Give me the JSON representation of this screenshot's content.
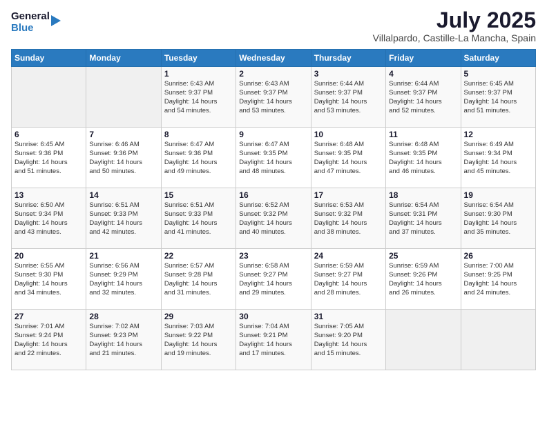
{
  "logo": {
    "general": "General",
    "blue": "Blue"
  },
  "title": "July 2025",
  "location": "Villalpardo, Castille-La Mancha, Spain",
  "headers": [
    "Sunday",
    "Monday",
    "Tuesday",
    "Wednesday",
    "Thursday",
    "Friday",
    "Saturday"
  ],
  "weeks": [
    [
      {
        "day": "",
        "info": ""
      },
      {
        "day": "",
        "info": ""
      },
      {
        "day": "1",
        "info": "Sunrise: 6:43 AM\nSunset: 9:37 PM\nDaylight: 14 hours\nand 54 minutes."
      },
      {
        "day": "2",
        "info": "Sunrise: 6:43 AM\nSunset: 9:37 PM\nDaylight: 14 hours\nand 53 minutes."
      },
      {
        "day": "3",
        "info": "Sunrise: 6:44 AM\nSunset: 9:37 PM\nDaylight: 14 hours\nand 53 minutes."
      },
      {
        "day": "4",
        "info": "Sunrise: 6:44 AM\nSunset: 9:37 PM\nDaylight: 14 hours\nand 52 minutes."
      },
      {
        "day": "5",
        "info": "Sunrise: 6:45 AM\nSunset: 9:37 PM\nDaylight: 14 hours\nand 51 minutes."
      }
    ],
    [
      {
        "day": "6",
        "info": "Sunrise: 6:45 AM\nSunset: 9:36 PM\nDaylight: 14 hours\nand 51 minutes."
      },
      {
        "day": "7",
        "info": "Sunrise: 6:46 AM\nSunset: 9:36 PM\nDaylight: 14 hours\nand 50 minutes."
      },
      {
        "day": "8",
        "info": "Sunrise: 6:47 AM\nSunset: 9:36 PM\nDaylight: 14 hours\nand 49 minutes."
      },
      {
        "day": "9",
        "info": "Sunrise: 6:47 AM\nSunset: 9:35 PM\nDaylight: 14 hours\nand 48 minutes."
      },
      {
        "day": "10",
        "info": "Sunrise: 6:48 AM\nSunset: 9:35 PM\nDaylight: 14 hours\nand 47 minutes."
      },
      {
        "day": "11",
        "info": "Sunrise: 6:48 AM\nSunset: 9:35 PM\nDaylight: 14 hours\nand 46 minutes."
      },
      {
        "day": "12",
        "info": "Sunrise: 6:49 AM\nSunset: 9:34 PM\nDaylight: 14 hours\nand 45 minutes."
      }
    ],
    [
      {
        "day": "13",
        "info": "Sunrise: 6:50 AM\nSunset: 9:34 PM\nDaylight: 14 hours\nand 43 minutes."
      },
      {
        "day": "14",
        "info": "Sunrise: 6:51 AM\nSunset: 9:33 PM\nDaylight: 14 hours\nand 42 minutes."
      },
      {
        "day": "15",
        "info": "Sunrise: 6:51 AM\nSunset: 9:33 PM\nDaylight: 14 hours\nand 41 minutes."
      },
      {
        "day": "16",
        "info": "Sunrise: 6:52 AM\nSunset: 9:32 PM\nDaylight: 14 hours\nand 40 minutes."
      },
      {
        "day": "17",
        "info": "Sunrise: 6:53 AM\nSunset: 9:32 PM\nDaylight: 14 hours\nand 38 minutes."
      },
      {
        "day": "18",
        "info": "Sunrise: 6:54 AM\nSunset: 9:31 PM\nDaylight: 14 hours\nand 37 minutes."
      },
      {
        "day": "19",
        "info": "Sunrise: 6:54 AM\nSunset: 9:30 PM\nDaylight: 14 hours\nand 35 minutes."
      }
    ],
    [
      {
        "day": "20",
        "info": "Sunrise: 6:55 AM\nSunset: 9:30 PM\nDaylight: 14 hours\nand 34 minutes."
      },
      {
        "day": "21",
        "info": "Sunrise: 6:56 AM\nSunset: 9:29 PM\nDaylight: 14 hours\nand 32 minutes."
      },
      {
        "day": "22",
        "info": "Sunrise: 6:57 AM\nSunset: 9:28 PM\nDaylight: 14 hours\nand 31 minutes."
      },
      {
        "day": "23",
        "info": "Sunrise: 6:58 AM\nSunset: 9:27 PM\nDaylight: 14 hours\nand 29 minutes."
      },
      {
        "day": "24",
        "info": "Sunrise: 6:59 AM\nSunset: 9:27 PM\nDaylight: 14 hours\nand 28 minutes."
      },
      {
        "day": "25",
        "info": "Sunrise: 6:59 AM\nSunset: 9:26 PM\nDaylight: 14 hours\nand 26 minutes."
      },
      {
        "day": "26",
        "info": "Sunrise: 7:00 AM\nSunset: 9:25 PM\nDaylight: 14 hours\nand 24 minutes."
      }
    ],
    [
      {
        "day": "27",
        "info": "Sunrise: 7:01 AM\nSunset: 9:24 PM\nDaylight: 14 hours\nand 22 minutes."
      },
      {
        "day": "28",
        "info": "Sunrise: 7:02 AM\nSunset: 9:23 PM\nDaylight: 14 hours\nand 21 minutes."
      },
      {
        "day": "29",
        "info": "Sunrise: 7:03 AM\nSunset: 9:22 PM\nDaylight: 14 hours\nand 19 minutes."
      },
      {
        "day": "30",
        "info": "Sunrise: 7:04 AM\nSunset: 9:21 PM\nDaylight: 14 hours\nand 17 minutes."
      },
      {
        "day": "31",
        "info": "Sunrise: 7:05 AM\nSunset: 9:20 PM\nDaylight: 14 hours\nand 15 minutes."
      },
      {
        "day": "",
        "info": ""
      },
      {
        "day": "",
        "info": ""
      }
    ]
  ]
}
